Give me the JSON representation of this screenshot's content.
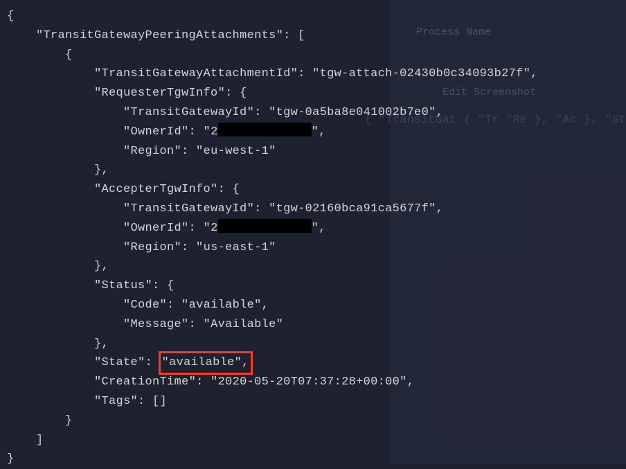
{
  "json": {
    "rootKey": "TransitGatewayPeeringAttachments",
    "attachmentId": {
      "key": "TransitGatewayAttachmentId",
      "value": "tgw-attach-02430b0c34093b27f"
    },
    "requester": {
      "key": "RequesterTgwInfo",
      "tgwId": {
        "key": "TransitGatewayId",
        "value": "tgw-0a5ba8e041002b7e0"
      },
      "ownerId": {
        "key": "OwnerId",
        "prefix": "2"
      },
      "region": {
        "key": "Region",
        "value": "eu-west-1"
      }
    },
    "accepter": {
      "key": "AccepterTgwInfo",
      "tgwId": {
        "key": "TransitGatewayId",
        "value": "tgw-02160bca91ca5677f"
      },
      "ownerId": {
        "key": "OwnerId",
        "prefix": "2"
      },
      "region": {
        "key": "Region",
        "value": "us-east-1"
      }
    },
    "status": {
      "key": "Status",
      "code": {
        "key": "Code",
        "value": "available"
      },
      "message": {
        "key": "Message",
        "value": "Available"
      }
    },
    "state": {
      "key": "State",
      "value": "available"
    },
    "creationTime": {
      "key": "CreationTime",
      "value": "2020-05-20T07:37:28+00:00"
    },
    "tags": {
      "key": "Tags"
    }
  },
  "background": {
    "processName": "Process Name",
    "editScreenshot": "Edit Screenshot",
    "line1": "{",
    "line2": "    \"TransitGat",
    "line3": "        {",
    "line4": "            \"Tr",
    "line5": "            \"Re",
    "line6": "",
    "line7": "",
    "line8": "",
    "line9": "            },",
    "line10": "            \"Ac",
    "line11": "",
    "line12": "",
    "line13": "",
    "line14": "            },",
    "line15": "            \"St"
  }
}
